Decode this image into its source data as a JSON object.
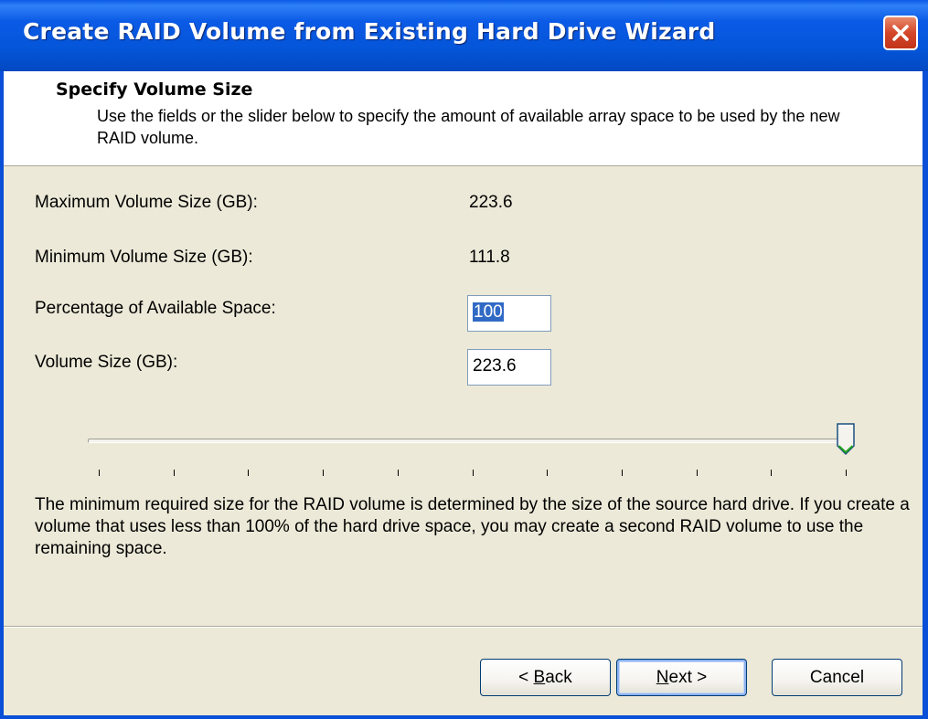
{
  "window": {
    "title": "Create RAID Volume from Existing Hard Drive Wizard"
  },
  "header": {
    "title": "Specify Volume Size",
    "description": "Use the fields or the slider below to specify the amount of available array space to be used by the new RAID volume."
  },
  "fields": {
    "max_label": "Maximum Volume Size (GB):",
    "max_value": "223.6",
    "min_label": "Minimum Volume Size (GB):",
    "min_value": "111.8",
    "percentage_label": "Percentage of Available Space:",
    "percentage_value": "100",
    "volume_label": "Volume Size (GB):",
    "volume_value": "223.6"
  },
  "slider": {
    "min": 0,
    "max": 100,
    "value": 100,
    "tick_count": 11
  },
  "info_text": "The minimum required size for the RAID volume is determined by the size of the source hard drive. If you create a volume that uses less than 100% of the hard drive space, you may create a second RAID volume to use the remaining space.",
  "buttons": {
    "back_mnemonic": "B",
    "back_rest": "ack",
    "back_prefix": "< ",
    "next_mnemonic": "N",
    "next_rest": "ext",
    "next_suffix": " >",
    "cancel": "Cancel"
  },
  "colors": {
    "titlebar": "#0a5ae8",
    "close": "#d4462a",
    "dialog_bg": "#ece9d8",
    "selection": "#316ac5"
  }
}
